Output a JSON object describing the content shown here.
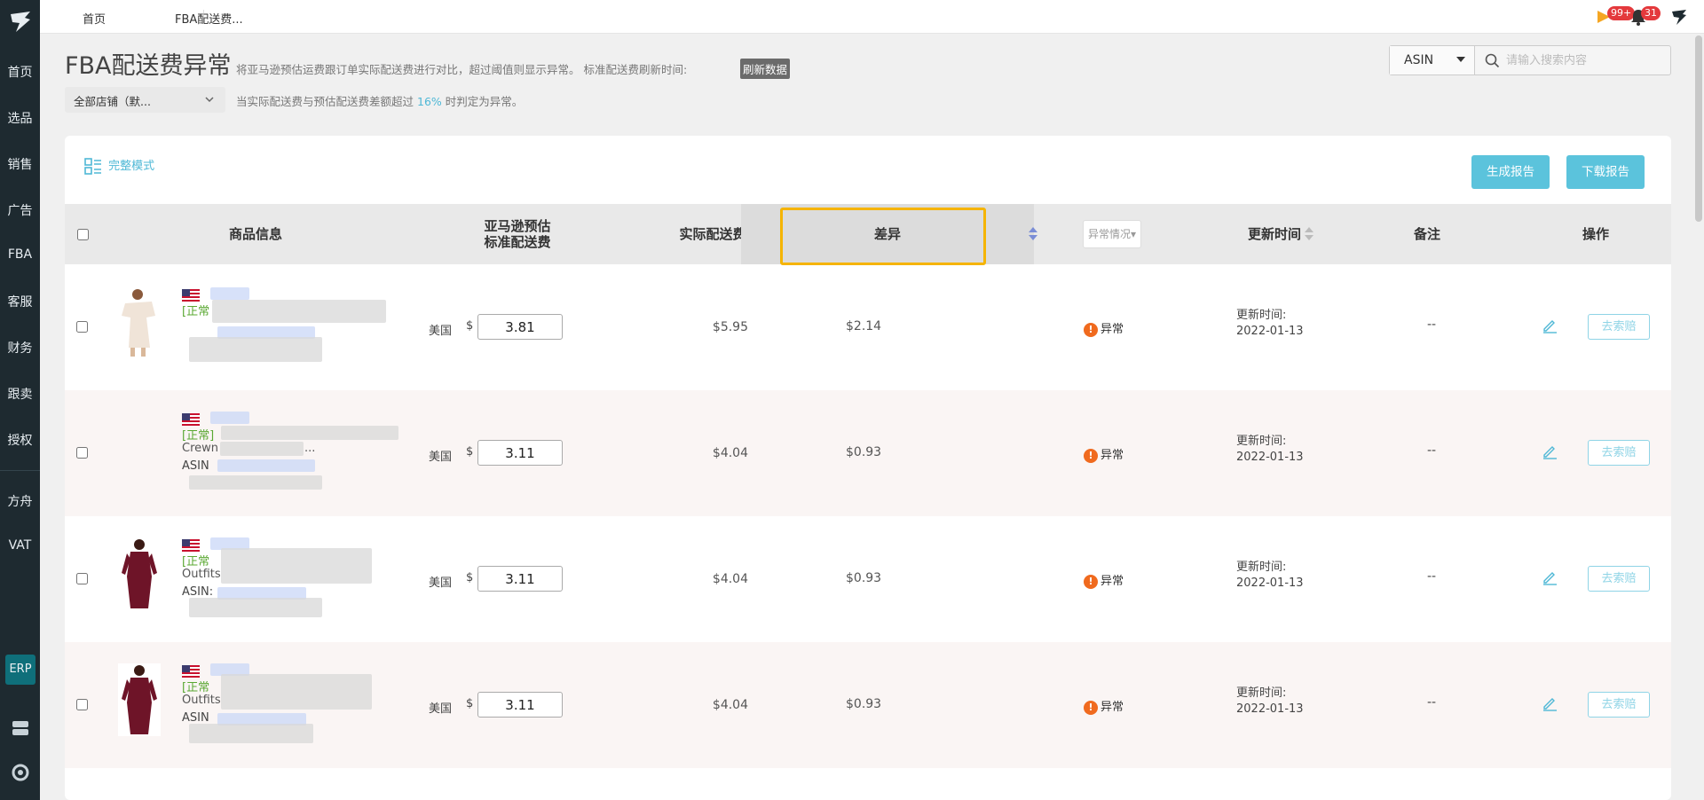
{
  "sidebar": {
    "items": [
      {
        "label": "首页"
      },
      {
        "label": "选品"
      },
      {
        "label": "销售"
      },
      {
        "label": "广告"
      },
      {
        "label": "FBA"
      },
      {
        "label": "客服"
      },
      {
        "label": "财务"
      },
      {
        "label": "跟卖"
      },
      {
        "label": "授权"
      },
      {
        "label": "方舟"
      },
      {
        "label": "VAT"
      }
    ],
    "erp_label": "ERP"
  },
  "topbar": {
    "breadcrumbs": [
      "首页",
      "FBA配送费..."
    ],
    "flag_badge": "99+",
    "bell_badge": "31"
  },
  "header": {
    "title": "FBA配送费异常",
    "description": "将亚马逊预估运费跟订单实际配送费进行对比，超过阈值则显示异常。 标准配送费刷新时间:",
    "refresh_label": "刷新数据",
    "store_select": "全部店铺（默...",
    "threshold_prefix": "当实际配送费与预估配送费差额超过",
    "threshold_pct": "16%",
    "threshold_suffix": "时判定为异常。"
  },
  "search": {
    "type": "ASIN",
    "placeholder": "请输入搜索内容"
  },
  "toolbar": {
    "mode_label": "完整模式",
    "generate_report": "生成报告",
    "download_report": "下载报告"
  },
  "table": {
    "headers": {
      "product": "商品信息",
      "estimated_line1": "亚马逊预估",
      "estimated_line2": "标准配送费",
      "actual": "实际配送费",
      "diff": "差异",
      "status_filter": "异常情况",
      "updated": "更新时间",
      "note": "备注",
      "action": "操作"
    },
    "rows": [
      {
        "status_tag": "[正常",
        "title_frag": "",
        "asin_frag": "",
        "country": "美国",
        "currency": "$",
        "estimated": "3.81",
        "actual": "$5.95",
        "diff": "$2.14",
        "abnormal": "异常",
        "updated_label": "更新时间:",
        "updated_date": "2022-01-13",
        "note": "--",
        "claim": "去索赔"
      },
      {
        "status_tag": "[正常]",
        "title_frag": "Crewn",
        "title_tail": "...",
        "asin_frag": "ASIN",
        "country": "美国",
        "currency": "$",
        "estimated": "3.11",
        "actual": "$4.04",
        "diff": "$0.93",
        "abnormal": "异常",
        "updated_label": "更新时间:",
        "updated_date": "2022-01-13",
        "note": "--",
        "claim": "去索赔"
      },
      {
        "status_tag": "[正常",
        "title_frag": "Outfits",
        "asin_frag": "ASIN:",
        "country": "美国",
        "currency": "$",
        "estimated": "3.11",
        "actual": "$4.04",
        "diff": "$0.93",
        "abnormal": "异常",
        "updated_label": "更新时间:",
        "updated_date": "2022-01-13",
        "note": "--",
        "claim": "去索赔"
      },
      {
        "status_tag": "[正常",
        "title_frag": "Outfits",
        "asin_frag": "ASIN",
        "country": "美国",
        "currency": "$",
        "estimated": "3.11",
        "actual": "$4.04",
        "diff": "$0.93",
        "abnormal": "异常",
        "updated_label": "更新时间:",
        "updated_date": "2022-01-13",
        "note": "--",
        "claim": "去索赔"
      }
    ]
  },
  "colors": {
    "sidebar_bg": "#1e2a30",
    "accent": "#5bc3dc",
    "highlight_border": "#f5b400",
    "abnormal_dot": "#f06a1e",
    "ok_status": "#5aa832"
  }
}
